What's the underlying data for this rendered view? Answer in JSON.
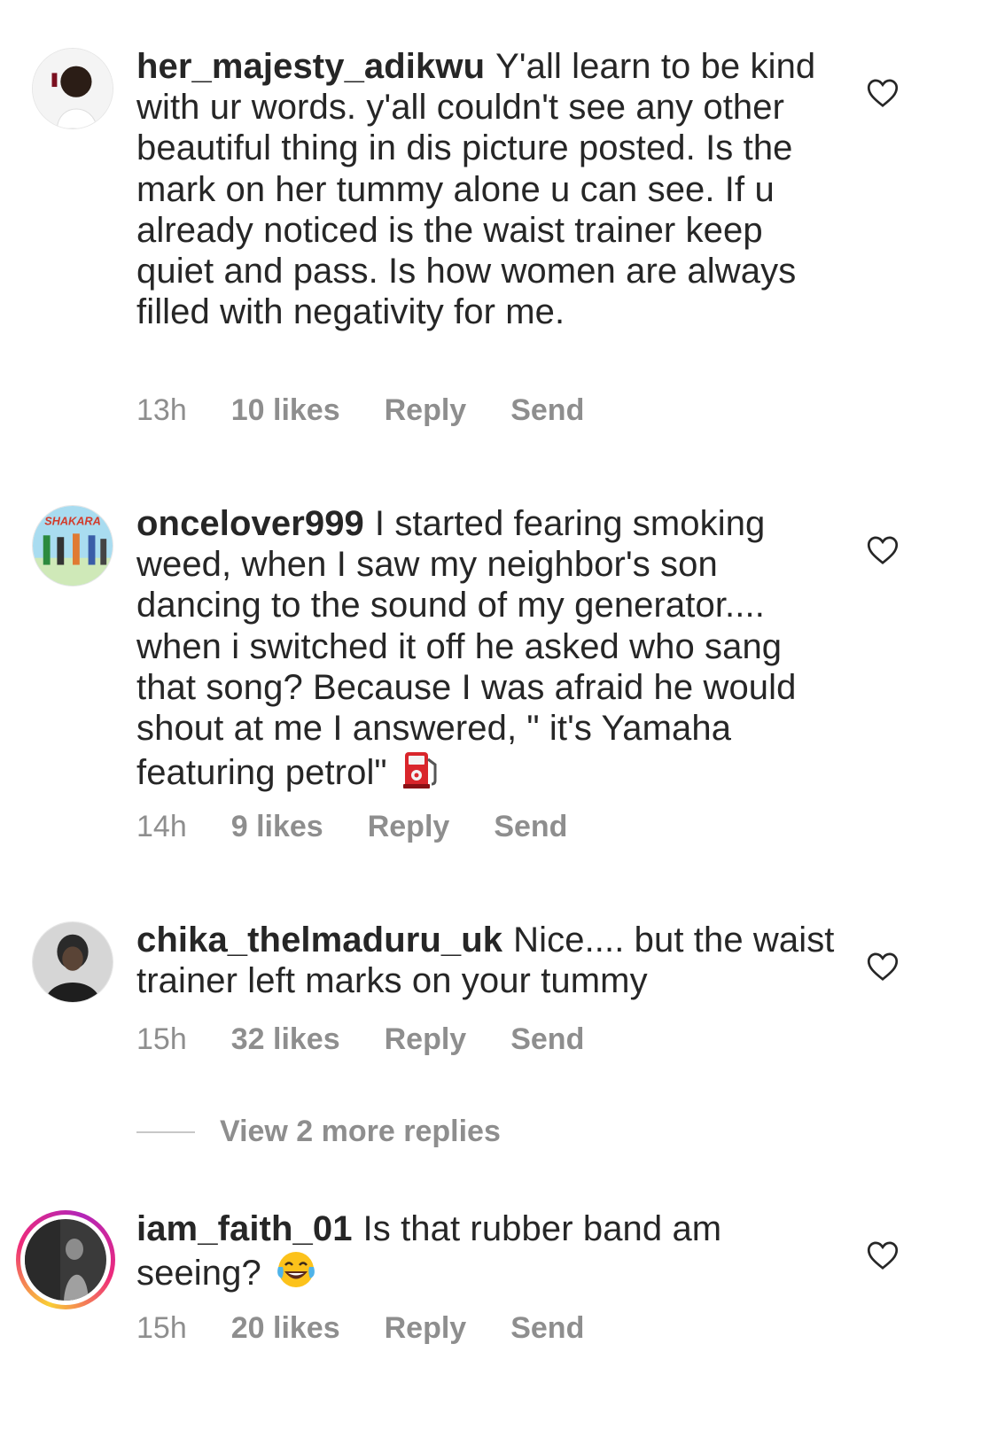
{
  "comments": [
    {
      "username": "her_majesty_adikwu",
      "text": "Y'all learn to be kind with ur words. y'all couldn't see any other beautiful thing in dis picture posted. Is the mark on her tummy alone u can see.  If u already noticed is the waist trainer keep quiet and pass. Is how women are always filled with negativity for me.",
      "time": "13h",
      "likes": "10 likes",
      "reply": "Reply",
      "send": "Send"
    },
    {
      "username": "oncelover999",
      "text": "I started fearing smoking weed, when I saw my neighbor's son dancing to the sound of my generator.... when i switched it off he asked who sang that song? Because I was afraid he would shout at me I answered, \" it's Yamaha featuring petrol\"",
      "emoji": "fuel-pump-emoji",
      "time": "14h",
      "likes": "9 likes",
      "reply": "Reply",
      "send": "Send"
    },
    {
      "username": "chika_thelmaduru_uk",
      "text": "Nice.... but the waist trainer left marks on your tummy",
      "time": "15h",
      "likes": "32 likes",
      "reply": "Reply",
      "send": "Send"
    },
    {
      "username": "iam_faith_01",
      "text": "Is that rubber band am seeing?",
      "emoji": "tears-of-joy-emoji",
      "time": "15h",
      "likes": "20 likes",
      "reply": "Reply",
      "send": "Send"
    }
  ],
  "view_replies": "View 2 more replies",
  "icons": {
    "like": "heart-outline-icon"
  },
  "colors": {
    "text": "#262626",
    "meta": "#8e8e8e",
    "heart": "#262626"
  }
}
